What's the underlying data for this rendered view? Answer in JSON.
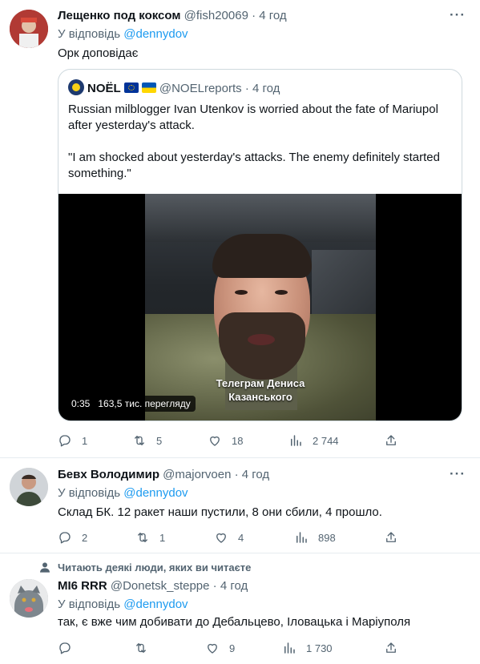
{
  "tweets": [
    {
      "author_name": "Лещенко под коксом",
      "handle": "@fish20069",
      "time": "· 4 год",
      "reply_prefix": "У відповідь",
      "reply_to": "@dennydov",
      "text": "Орк доповідає",
      "quote": {
        "author_name": "NOЁL",
        "handle": "@NOELreports",
        "time": "· 4 год",
        "paragraph1": "Russian milblogger Ivan Utenkov is worried about the fate of Mariupol after yesterday's attack.",
        "paragraph2": "\"I am shocked about yesterday's attacks. The enemy definitely started something.\"",
        "video_caption_line1": "Телеграм Дениса",
        "video_caption_line2": "Казанського",
        "video_time": "0:35",
        "video_views": "163,5 тис. перегляду"
      },
      "actions": {
        "replies": "1",
        "retweets": "5",
        "likes": "18",
        "views": "2 744"
      }
    },
    {
      "author_name": "Бевх Володимир",
      "handle": "@majorvoen",
      "time": "· 4 год",
      "reply_prefix": "У відповідь",
      "reply_to": "@dennydov",
      "text": "Склад БК. 12 ракет наши пустили, 8 они сбили, 4 прошло.",
      "actions": {
        "replies": "2",
        "retweets": "1",
        "likes": "4",
        "views": "898"
      }
    },
    {
      "follow_note": "Читають деякі люди, яких ви читаєте",
      "author_name": "MI6 RRR",
      "handle": "@Donetsk_steppe",
      "time": "· 4 год",
      "reply_prefix": "У відповідь",
      "reply_to": "@dennydov",
      "text": "так, є вже чим добивати до Дебальцево, Іловацька і Маріуполя",
      "actions": {
        "replies": "",
        "retweets": "",
        "likes": "9",
        "views": "1 730"
      }
    }
  ],
  "more_label": "···",
  "colors": {
    "accent": "#1d9bf0",
    "muted": "#536471",
    "border": "#cfd9de"
  },
  "icons": [
    "reply-icon",
    "retweet-icon",
    "like-icon",
    "views-icon",
    "share-icon",
    "more-icon",
    "person-icon"
  ]
}
